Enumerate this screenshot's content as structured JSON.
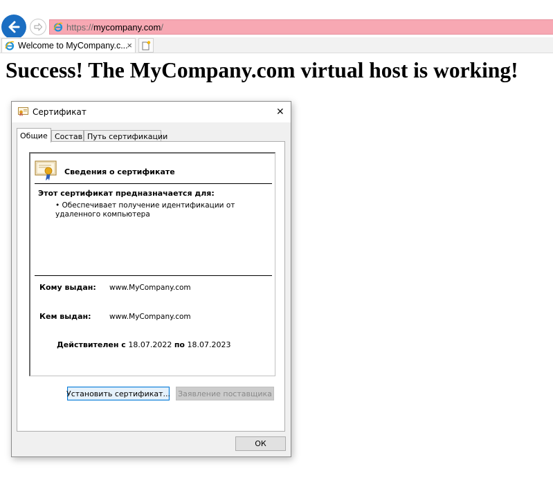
{
  "browser": {
    "url_scheme": "https://",
    "url_host": "mycompany.com",
    "url_path": "/",
    "tab_title": "Welcome to MyCompany.c...",
    "tab_close": "×",
    "accent_color": "#1b6ec2",
    "address_bar_color": "#f7a8b3",
    "icons": [
      "back-arrow-icon",
      "forward-arrow-icon",
      "ie-logo-icon",
      "close-icon",
      "new-tab-icon"
    ]
  },
  "page": {
    "heading": "Success! The MyCompany.com virtual host is working!"
  },
  "dialog": {
    "title": "Сертификат",
    "close": "✕",
    "tabs": [
      {
        "label": "Общие",
        "active": true
      },
      {
        "label": "Состав",
        "active": false
      },
      {
        "label": "Путь сертификации",
        "active": false
      }
    ],
    "info_title": "Сведения о сертификате",
    "purpose_heading": "Этот сертификат предназначается для:",
    "purpose_item": "• Обеспечивает получение идентификации от удаленного компьютера",
    "issued_to_label": "Кому выдан:",
    "issued_to_value": "www.MyCompany.com",
    "issued_by_label": "Кем выдан:",
    "issued_by_value": "www.MyCompany.com",
    "valid_from_label": "Действителен с",
    "valid_from": "18.07.2022",
    "valid_to_label": "по",
    "valid_to": "18.07.2023",
    "install_button": "Установить сертификат...",
    "issuer_statement_button": "Заявление поставщика",
    "ok_button": "ОК"
  }
}
